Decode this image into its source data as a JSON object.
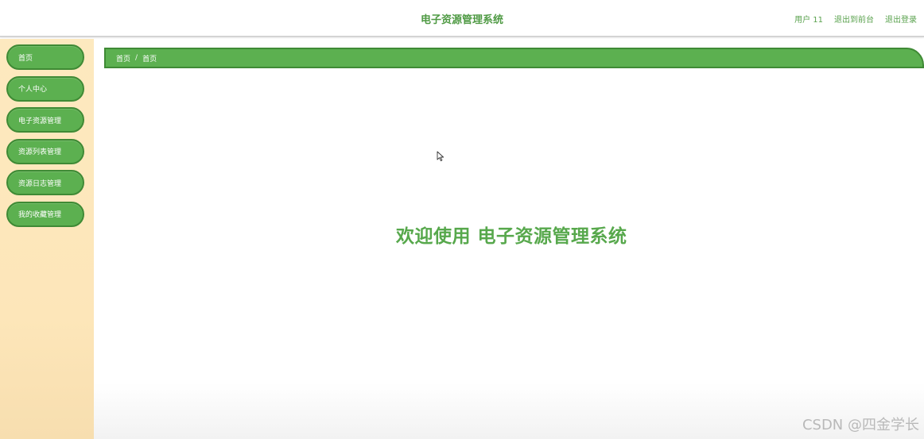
{
  "header": {
    "title": "电子资源管理系统",
    "user": "用户 11",
    "back_to_front": "退出到前台",
    "logout": "退出登录"
  },
  "sidebar": {
    "items": [
      {
        "label": "首页"
      },
      {
        "label": "个人中心"
      },
      {
        "label": "电子资源管理"
      },
      {
        "label": "资源列表管理"
      },
      {
        "label": "资源日志管理"
      },
      {
        "label": "我的收藏管理"
      }
    ]
  },
  "breadcrumb": {
    "items": [
      "首页",
      "首页"
    ],
    "separator": "/"
  },
  "main": {
    "welcome": "欢迎使用 电子资源管理系统"
  },
  "watermark": "CSDN @四金学长",
  "colors": {
    "primary": "#5cb050",
    "primary_border": "#3f8a35",
    "sidebar_bg": "#fde9bf",
    "title_text": "#4f9a44"
  }
}
